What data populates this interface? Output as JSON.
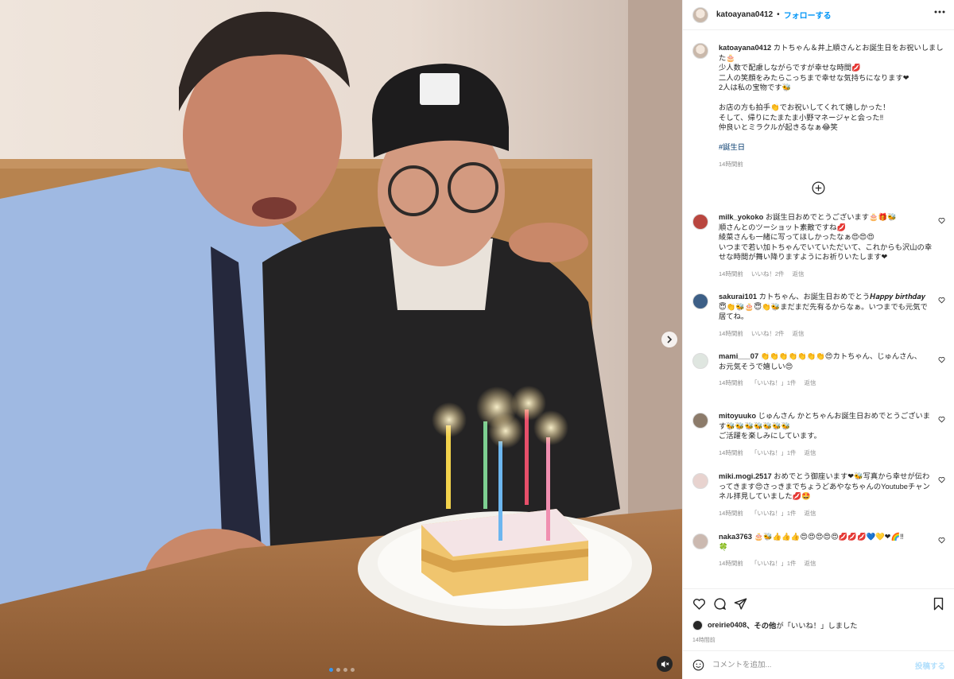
{
  "post": {
    "username": "katoayana0412",
    "separator": "•",
    "follow_label": "フォローする",
    "more_icon": "more-horizontal-icon"
  },
  "media": {
    "current_slide": 1,
    "slide_count": 4,
    "next_icon": "chevron-right-icon",
    "mute_icon": "speaker-muted-icon"
  },
  "caption": {
    "username": "katoayana0412",
    "lines": [
      "カトちゃん＆井上順さんとお誕生日をお祝いしました🎂",
      "少人数で配慮しながらですが幸せな時間💋",
      "二人の笑顔をみたらこっちまで幸せな気持ちになります❤",
      "2人は私の宝物です🐝",
      "",
      "お店の方も拍手👏でお祝いしてくれて嬉しかった！",
      "そして、帰りにたまたま小野マネージャと会った‼",
      "仲良いとミラクルが起きるなぁ😂笑"
    ],
    "hashtag": "#誕生日",
    "time": "14時間前"
  },
  "load_more_icon": "plus-circle-icon",
  "comments": [
    {
      "username": "milk_yokoko",
      "text": "お誕生日おめでとうございます🎂🎁🐝\n順さんとのツーショット素敵ですね💋\n綾菜さんも一緒に写ってほしかったなぁ😍😍😍\nいつまで若い加トちゃんでいていただいて、これからも沢山の幸せな時間が舞い降りますようにお祈りいたします❤",
      "time": "14時間前",
      "likes": "いいね！2件",
      "reply": "返信",
      "avatar_color": "#b9463f"
    },
    {
      "username": "sakurai101",
      "text": "カトちゃん、お誕生日おめでとう𝑯𝒂𝒑𝒑𝒚 𝒃𝒊𝒓𝒕𝒉𝒅𝒂𝒚\n😇👏🐝🎂😇👏🐝まだまだ先有るからなぁ。いつまでも元気で居てね。",
      "time": "14時間前",
      "likes": "いいね！2件",
      "reply": "返信",
      "avatar_color": "#3d5f86"
    },
    {
      "username": "mami___07",
      "text": "👏👏👏👏👏👏👏😍カトちゃん、じゅんさん、\nお元気そうで嬉しい😍",
      "time": "14時間前",
      "likes": "「いいね！」1件",
      "reply": "返信",
      "avatar_color": "#dfe6e0"
    },
    {
      "username": "mitoyuuko",
      "text": "じゅんさん かとちゃんお誕生日おめでとうございます🐝🐝🐝🐝🐝🐝🐝\nご活躍を楽しみにしています。",
      "time": "14時間前",
      "likes": "「いいね！」1件",
      "reply": "返信",
      "avatar_color": "#8c7b6a"
    },
    {
      "username": "miki.mogi.2517",
      "text": "おめでとう御座います❤🐝写真から幸せが伝わってきます😍さっきまでちょうどあやなちゃんのYoutubeチャンネル拝見していました💋🤩",
      "time": "14時間前",
      "likes": "「いいね！」1件",
      "reply": "返信",
      "avatar_color": "#e8d3cf"
    },
    {
      "username": "naka3763",
      "text": "🎂🐝👍👍👍😍😍😍😍😍💋💋💋💙💛❤🌈‼\n🍀",
      "time": "14時間前",
      "likes": "「いいね！」1件",
      "reply": "返信",
      "avatar_color": "#cbb9b0"
    }
  ],
  "heart_icon": "heart-outline-icon",
  "actions": {
    "like_icon": "heart-outline-icon",
    "comment_icon": "comment-bubble-icon",
    "share_icon": "paper-plane-icon",
    "save_icon": "bookmark-icon"
  },
  "liked_by": {
    "username": "oreirie0408",
    "suffix_user": "、その他",
    "suffix_text": "が「いいね！」しました",
    "time": "14時間前"
  },
  "add_comment": {
    "smile_icon": "emoji-smile-icon",
    "placeholder": "コメントを追加...",
    "post_label": "投稿する"
  }
}
